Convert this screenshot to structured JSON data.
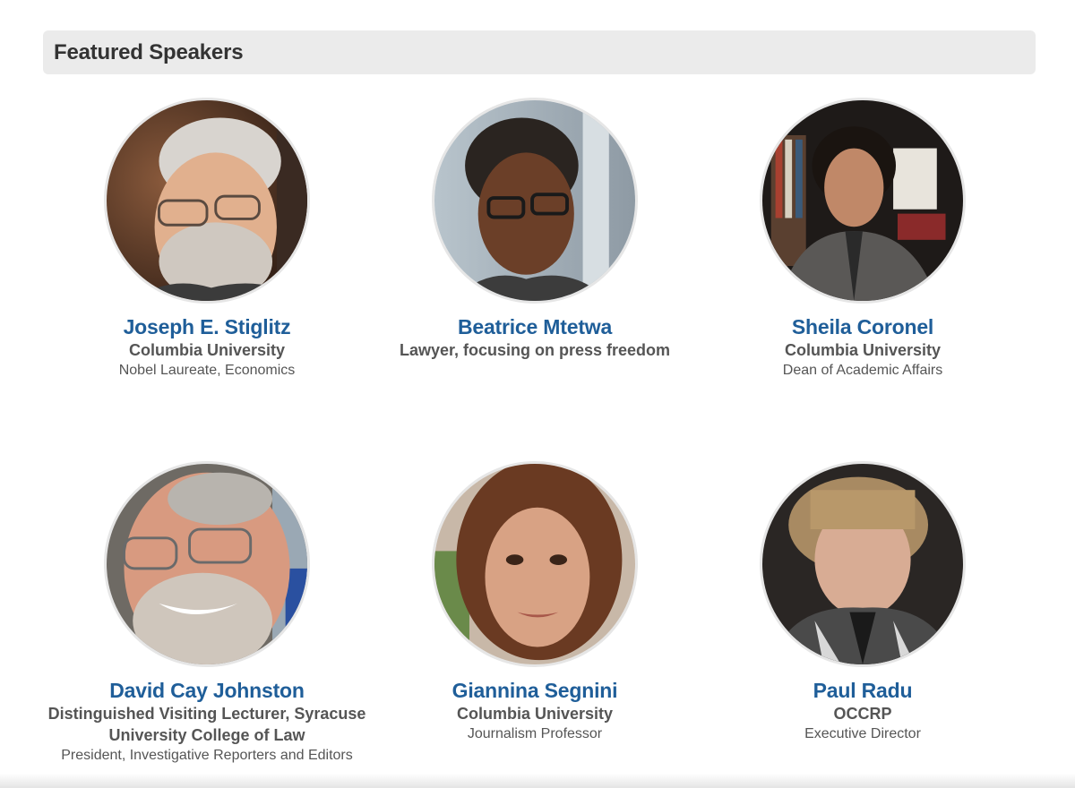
{
  "section": {
    "title": "Featured Speakers"
  },
  "speakers": [
    {
      "name": "Joseph E. Stiglitz",
      "organization": "Columbia University",
      "role": "Nobel Laureate, Economics",
      "photo": "portrait-joseph-stiglitz"
    },
    {
      "name": "Beatrice Mtetwa",
      "organization": "Lawyer, focusing on press freedom",
      "role": "",
      "photo": "portrait-beatrice-mtetwa"
    },
    {
      "name": "Sheila Coronel",
      "organization": "Columbia University",
      "role": "Dean of Academic Affairs",
      "photo": "portrait-sheila-coronel"
    },
    {
      "name": "David Cay Johnston",
      "organization": "Distinguished Visiting Lecturer, Syracuse University College of Law",
      "role": "President, Investigative Reporters and Editors",
      "photo": "portrait-david-cay-johnston"
    },
    {
      "name": "Giannina Segnini",
      "organization": "Columbia University",
      "role": "Journalism Professor",
      "photo": "portrait-giannina-segnini"
    },
    {
      "name": "Paul Radu",
      "organization": "OCCRP",
      "role": "Executive Director",
      "photo": "portrait-paul-radu"
    }
  ],
  "colors": {
    "name_link": "#1f5e99",
    "text": "#555555",
    "header_bg": "#ebebeb"
  }
}
